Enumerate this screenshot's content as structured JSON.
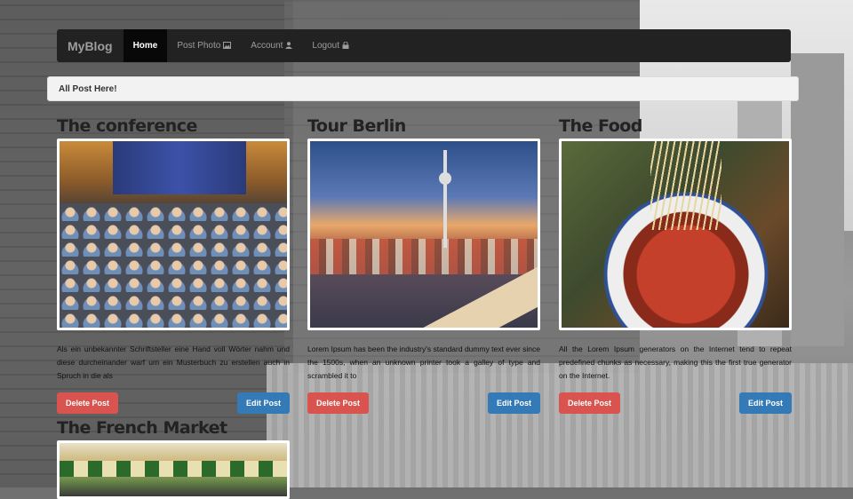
{
  "navbar": {
    "brand": "MyBlog",
    "items": [
      {
        "label": "Home",
        "icon": ""
      },
      {
        "label": "Post Photo",
        "icon": "picture-icon"
      },
      {
        "label": "Account",
        "icon": "user-icon"
      },
      {
        "label": "Logout",
        "icon": "lock-icon"
      }
    ]
  },
  "alert": {
    "text": "All Post Here!"
  },
  "posts": [
    {
      "title": "The conference",
      "text": "Als ein unbekannter Schriftsteller eine Hand voll Wörter nahm und diese durcheinander warf um ein Musterbuch zu erstellen auch in Spruch in die als",
      "delete_label": "Delete Post",
      "edit_label": "Edit Post"
    },
    {
      "title": "Tour Berlin",
      "text": "Lorem Ipsum has been the industry's standard dummy text ever since the 1500s, when an unknown printer took a galley of type and scrambled it to",
      "delete_label": "Delete Post",
      "edit_label": "Edit Post"
    },
    {
      "title": "The Food",
      "text": "All the Lorem Ipsum generators on the Internet tend to repeat predefined chunks as necessary, making this the first true generator on the Internet.",
      "delete_label": "Delete Post",
      "edit_label": "Edit Post"
    },
    {
      "title": "The French Market",
      "text": "",
      "delete_label": "",
      "edit_label": ""
    }
  ],
  "colors": {
    "navbar": "#222222",
    "danger": "#d9534f",
    "primary": "#337ab7"
  }
}
